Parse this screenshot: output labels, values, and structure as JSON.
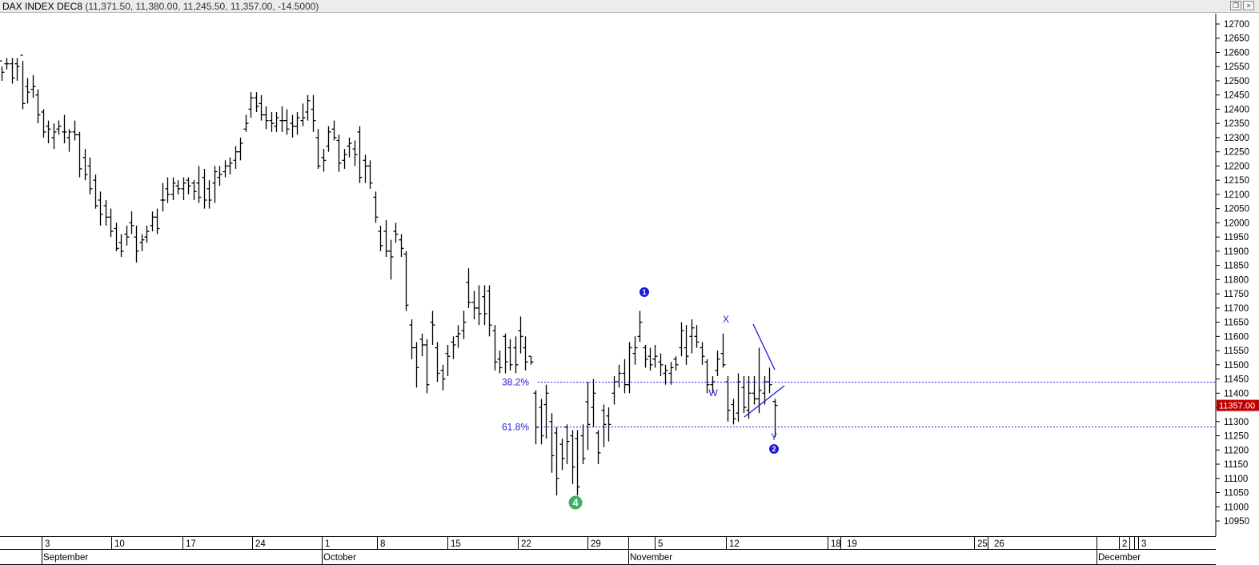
{
  "window": {
    "symbol": "DAX INDEX DEC8",
    "ohlc_text": "(11,371.50, 11,380.00, 11,245.50, 11,357.00, -14.5000)",
    "restore_glyph": "❐",
    "close_glyph": "×"
  },
  "colors": {
    "bars": "#000000",
    "fib_line": "#2323d6",
    "wave_blue": "#1a1ad9",
    "wave_green": "#3fae66",
    "price_box": "#c00000"
  },
  "chart_data": {
    "type": "ohlc",
    "ylim": [
      10900,
      12725
    ],
    "y_ticks": [
      10950,
      11000,
      11050,
      11100,
      11150,
      11200,
      11250,
      11300,
      11350,
      11400,
      11450,
      11500,
      11550,
      11600,
      11650,
      11700,
      11750,
      11800,
      11850,
      11900,
      11950,
      12000,
      12050,
      12100,
      12150,
      12200,
      12250,
      12300,
      12350,
      12400,
      12450,
      12500,
      12550,
      12600,
      12650,
      12700
    ],
    "last_price_label": "11357.00",
    "last_price": 11357,
    "day_labels": [
      "3",
      "10",
      "17",
      "24",
      "1",
      "8",
      "15",
      "22",
      "29",
      "5",
      "12",
      "18",
      "19",
      "25",
      "26",
      "2",
      "3"
    ],
    "month_labels": [
      "September",
      "October",
      "November",
      "December"
    ],
    "fib_levels": [
      {
        "label": "38.2%",
        "value": 11440
      },
      {
        "label": "61.8%",
        "value": 11283
      }
    ],
    "wave_labels": [
      {
        "text": "1",
        "style": "filled-blue"
      },
      {
        "text": "4",
        "style": "filled-green"
      },
      {
        "text": "2",
        "style": "filled-blue"
      },
      {
        "text": "W",
        "style": "letter"
      },
      {
        "text": "X",
        "style": "letter"
      },
      {
        "text": "Y",
        "style": "letter"
      }
    ],
    "bars": [
      [
        12570,
        12550,
        12500,
        12530
      ],
      [
        12560,
        12580,
        12540,
        12560
      ],
      [
        12560,
        12580,
        12490,
        12510
      ],
      [
        12560,
        12580,
        12500,
        12550
      ],
      [
        12590,
        12570,
        12400,
        12420
      ],
      [
        12480,
        12510,
        12420,
        12460
      ],
      [
        12470,
        12520,
        12440,
        12480
      ],
      [
        12450,
        12470,
        12350,
        12380
      ],
      [
        12390,
        12400,
        12300,
        12320
      ],
      [
        12340,
        12360,
        12280,
        12330
      ],
      [
        12300,
        12350,
        12260,
        12320
      ],
      [
        12330,
        12360,
        12310,
        12340
      ],
      [
        12320,
        12380,
        12280,
        12320
      ],
      [
        12300,
        12330,
        12250,
        12320
      ],
      [
        12320,
        12360,
        12290,
        12310
      ],
      [
        12310,
        12320,
        12160,
        12190
      ],
      [
        12230,
        12260,
        12150,
        12170
      ],
      [
        12200,
        12230,
        12100,
        12120
      ],
      [
        12150,
        12170,
        12050,
        12060
      ],
      [
        12080,
        12110,
        11990,
        12030
      ],
      [
        12060,
        12080,
        11990,
        12020
      ],
      [
        12020,
        12050,
        11950,
        11970
      ],
      [
        11980,
        12000,
        11900,
        11910
      ],
      [
        11930,
        11960,
        11880,
        11900
      ],
      [
        11960,
        11990,
        11920,
        11950
      ],
      [
        12000,
        12040,
        11960,
        11990
      ],
      [
        11950,
        11990,
        11860,
        11900
      ],
      [
        11930,
        11960,
        11900,
        11940
      ],
      [
        11950,
        11990,
        11930,
        11970
      ],
      [
        11990,
        12040,
        11970,
        12020
      ],
      [
        12020,
        12050,
        11960,
        11980
      ],
      [
        12080,
        12140,
        12040,
        12080
      ],
      [
        12120,
        12160,
        12070,
        12100
      ],
      [
        12100,
        12160,
        12080,
        12140
      ],
      [
        12130,
        12150,
        12100,
        12120
      ],
      [
        12120,
        12160,
        12080,
        12140
      ],
      [
        12150,
        12160,
        12100,
        12130
      ],
      [
        12140,
        12150,
        12080,
        12110
      ],
      [
        12140,
        12200,
        12070,
        12090
      ],
      [
        12160,
        12190,
        12050,
        12080
      ],
      [
        12120,
        12150,
        12050,
        12080
      ],
      [
        12140,
        12200,
        12070,
        12180
      ],
      [
        12160,
        12200,
        12130,
        12170
      ],
      [
        12180,
        12220,
        12160,
        12200
      ],
      [
        12200,
        12230,
        12170,
        12210
      ],
      [
        12220,
        12270,
        12190,
        12250
      ],
      [
        12250,
        12300,
        12220,
        12280
      ],
      [
        12330,
        12380,
        12320,
        12350
      ],
      [
        12400,
        12460,
        12370,
        12440
      ],
      [
        12440,
        12460,
        12390,
        12410
      ],
      [
        12420,
        12450,
        12360,
        12380
      ],
      [
        12380,
        12410,
        12330,
        12360
      ],
      [
        12360,
        12390,
        12320,
        12350
      ],
      [
        12340,
        12390,
        12320,
        12370
      ],
      [
        12360,
        12410,
        12320,
        12360
      ],
      [
        12360,
        12400,
        12310,
        12330
      ],
      [
        12350,
        12380,
        12300,
        12340
      ],
      [
        12340,
        12390,
        12310,
        12370
      ],
      [
        12360,
        12420,
        12340,
        12370
      ],
      [
        12390,
        12450,
        12360,
        12430
      ],
      [
        12400,
        12450,
        12320,
        12360
      ],
      [
        12300,
        12330,
        12190,
        12200
      ],
      [
        12230,
        12260,
        12180,
        12220
      ],
      [
        12270,
        12340,
        12250,
        12320
      ],
      [
        12330,
        12360,
        12290,
        12300
      ],
      [
        12290,
        12310,
        12180,
        12210
      ],
      [
        12220,
        12260,
        12190,
        12240
      ],
      [
        12270,
        12300,
        12230,
        12280
      ],
      [
        12260,
        12290,
        12200,
        12240
      ],
      [
        12320,
        12340,
        12140,
        12160
      ],
      [
        12220,
        12240,
        12140,
        12200
      ],
      [
        12200,
        12220,
        12120,
        12140
      ],
      [
        12090,
        12110,
        12000,
        12020
      ],
      [
        11970,
        11990,
        11900,
        11920
      ],
      [
        11970,
        12010,
        11880,
        11900
      ],
      [
        11900,
        11940,
        11800,
        11880
      ],
      [
        11970,
        12000,
        11930,
        11960
      ],
      [
        11940,
        11960,
        11880,
        11910
      ],
      [
        11890,
        11900,
        11690,
        11710
      ],
      [
        11640,
        11660,
        11520,
        11560
      ],
      [
        11560,
        11580,
        11420,
        11490
      ],
      [
        11590,
        11610,
        11530,
        11570
      ],
      [
        11570,
        11590,
        11400,
        11430
      ],
      [
        11650,
        11690,
        11570,
        11640
      ],
      [
        11560,
        11580,
        11440,
        11470
      ],
      [
        11480,
        11500,
        11410,
        11450
      ],
      [
        11540,
        11570,
        11460,
        11530
      ],
      [
        11580,
        11600,
        11520,
        11570
      ],
      [
        11600,
        11640,
        11560,
        11610
      ],
      [
        11620,
        11690,
        11590,
        11650
      ],
      [
        11790,
        11840,
        11700,
        11720
      ],
      [
        11720,
        11760,
        11660,
        11700
      ],
      [
        11700,
        11780,
        11640,
        11680
      ],
      [
        11740,
        11780,
        11640,
        11680
      ],
      [
        11760,
        11780,
        11600,
        11640
      ],
      [
        11620,
        11640,
        11480,
        11510
      ],
      [
        11520,
        11550,
        11470,
        11490
      ],
      [
        11600,
        11610,
        11470,
        11510
      ],
      [
        11560,
        11590,
        11480,
        11500
      ],
      [
        11560,
        11600,
        11470,
        11500
      ],
      [
        11620,
        11670,
        11540,
        11600
      ],
      [
        11560,
        11600,
        11480,
        11510
      ],
      [
        11530,
        11530,
        11500,
        11510
      ],
      [
        11400,
        11410,
        11220,
        11280
      ],
      [
        11350,
        11380,
        11220,
        11250
      ],
      [
        11360,
        11430,
        11240,
        11400
      ],
      [
        11300,
        11330,
        11120,
        11180
      ],
      [
        11260,
        11280,
        11040,
        11100
      ],
      [
        11220,
        11240,
        11130,
        11170
      ],
      [
        11280,
        11290,
        11150,
        11230
      ],
      [
        11250,
        11270,
        11080,
        11140
      ],
      [
        11240,
        11270,
        11040,
        11070
      ],
      [
        11250,
        11290,
        11150,
        11170
      ],
      [
        11370,
        11440,
        11200,
        11290
      ],
      [
        11350,
        11450,
        11280,
        11400
      ],
      [
        11260,
        11270,
        11150,
        11190
      ],
      [
        11340,
        11360,
        11210,
        11290
      ],
      [
        11320,
        11350,
        11230,
        11290
      ],
      [
        11400,
        11460,
        11360,
        11440
      ],
      [
        11440,
        11500,
        11420,
        11470
      ],
      [
        11470,
        11520,
        11400,
        11430
      ],
      [
        11430,
        11580,
        11400,
        11560
      ],
      [
        11540,
        11600,
        11500,
        11560
      ],
      [
        11600,
        11690,
        11580,
        11650
      ],
      [
        11560,
        11570,
        11490,
        11520
      ],
      [
        11530,
        11560,
        11480,
        11500
      ],
      [
        11520,
        11570,
        11490,
        11530
      ],
      [
        11510,
        11540,
        11460,
        11500
      ],
      [
        11470,
        11500,
        11430,
        11480
      ],
      [
        11470,
        11510,
        11430,
        11490
      ],
      [
        11520,
        11530,
        11480,
        11500
      ],
      [
        11560,
        11650,
        11530,
        11620
      ],
      [
        11560,
        11640,
        11500,
        11530
      ],
      [
        11600,
        11660,
        11540,
        11630
      ],
      [
        11600,
        11640,
        11560,
        11580
      ],
      [
        11560,
        11580,
        11500,
        11530
      ],
      [
        11510,
        11520,
        11400,
        11430
      ],
      [
        11430,
        11460,
        11400,
        11440
      ],
      [
        11480,
        11550,
        11460,
        11520
      ],
      [
        11540,
        11610,
        11490,
        11500
      ],
      [
        11440,
        11460,
        11300,
        11340
      ],
      [
        11360,
        11380,
        11290,
        11310
      ],
      [
        11330,
        11470,
        11300,
        11440
      ],
      [
        11420,
        11460,
        11330,
        11350
      ],
      [
        11340,
        11460,
        11310,
        11400
      ],
      [
        11400,
        11460,
        11360,
        11380
      ],
      [
        11380,
        11560,
        11330,
        11410
      ],
      [
        11400,
        11460,
        11360,
        11440
      ],
      [
        11440,
        11490,
        11400,
        11430
      ],
      [
        11371,
        11380,
        11245,
        11357
      ]
    ]
  }
}
